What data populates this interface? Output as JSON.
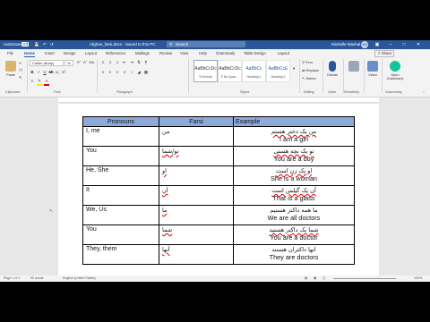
{
  "titlebar": {
    "autosave": "AutoSave",
    "autosave_state": "Off",
    "filename": "Afghan_farsi.docx - Saved to this PC",
    "search_icon": "search-icon",
    "search_placeholder": "Search",
    "user": "Michelle Mashal",
    "user_initials": "MM"
  },
  "tabs": [
    "File",
    "Home",
    "Insert",
    "Design",
    "Layout",
    "References",
    "Mailings",
    "Review",
    "View",
    "Help",
    "Grammarly",
    "Table Design",
    "Layout"
  ],
  "active_tab": "Home",
  "share_label": "Share",
  "ribbon": {
    "paste": "Paste",
    "clipboard": "Clipboard",
    "font_name": "Calibri (Body)",
    "font_size": "11",
    "font": "Font",
    "paragraph": "Paragraph",
    "styles": "Styles",
    "style_items": [
      {
        "sample": "AaBbCcDc",
        "name": "¶ Normal"
      },
      {
        "sample": "AaBbCcDc",
        "name": "¶ No Spac..."
      },
      {
        "sample": "AaBbCc",
        "name": "Heading 1"
      },
      {
        "sample": "AaBbCcE",
        "name": "Heading 2"
      }
    ],
    "find": "Find",
    "replace": "Replace",
    "select": "Select",
    "editing": "Editing",
    "dictate": "Dictate",
    "voice": "Voice",
    "sensitivity": "Sensitivity",
    "video": "Video",
    "open_grammarly": "Open Grammarly",
    "grammarly_group": "Grammarly"
  },
  "table": {
    "headers": [
      "Pronouns",
      "Farsi",
      "Example"
    ],
    "rows": [
      {
        "pronoun": "I, me",
        "farsi": "من",
        "farsi_flag": false,
        "ex_farsi": "من یک دختر هستم",
        "ex_flag": true,
        "ex_en": "I am a girl"
      },
      {
        "pronoun": "You",
        "farsi": "تو/شما",
        "farsi_flag": true,
        "ex_farsi": "تو یک بچه هستی",
        "ex_flag": true,
        "ex_en": "You are a boy"
      },
      {
        "pronoun": "He, She",
        "farsi": "او",
        "farsi_flag": true,
        "ex_farsi": "او یک زن است",
        "ex_flag": true,
        "ex_en": "She is a woman"
      },
      {
        "pronoun": "It",
        "farsi": "آن",
        "farsi_flag": true,
        "ex_farsi": "آن یک گیلس است",
        "ex_flag": true,
        "ex_en": "That is a glass"
      },
      {
        "pronoun": "We, Us",
        "farsi": "ما",
        "farsi_flag": true,
        "ex_farsi": "ما همه داکتر هستیم",
        "ex_flag": false,
        "ex_en": "We are all doctors"
      },
      {
        "pronoun": "You",
        "farsi": "شما",
        "farsi_flag": true,
        "ex_farsi": "شما یک داکتر هستید",
        "ex_flag": true,
        "ex_en": "You are a doctor"
      },
      {
        "pronoun": "They, them",
        "farsi": "آنها",
        "farsi_flag": true,
        "ex_farsi": "انها داکتران هستند",
        "ex_flag": false,
        "ex_en": "They are doctors"
      }
    ]
  },
  "status": {
    "page": "Page 1 of 1",
    "words": "90 words",
    "language": "English (United States)",
    "zoom": "100%"
  },
  "colors": {
    "titlebar": "#2b579a",
    "table_header": "#8eaadb",
    "spell_underline": "#dd0000"
  }
}
